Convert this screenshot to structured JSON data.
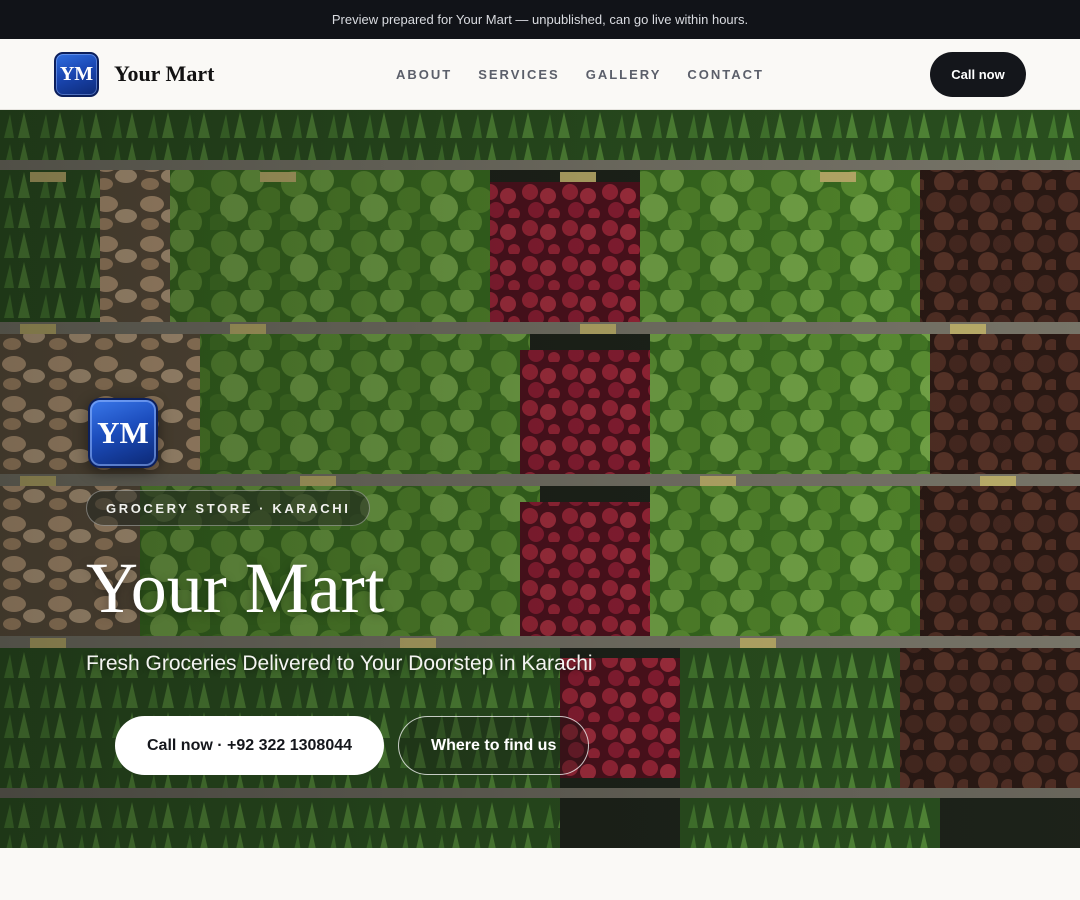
{
  "announcement": "Preview prepared for Your Mart — unpublished, can go live within hours.",
  "brand": {
    "monogram": "YM",
    "name": "Your Mart"
  },
  "nav": {
    "links": [
      "ABOUT",
      "SERVICES",
      "GALLERY",
      "CONTACT"
    ],
    "cta": "Call now"
  },
  "hero": {
    "monogram": "YM",
    "tag": "GROCERY STORE · KARACHI",
    "title": "Your Mart",
    "subtitle": "Fresh Groceries Delivered to Your Doorstep in Karachi",
    "primary_cta": "Call now · +92 322 1308044",
    "secondary_cta": "Where to find us",
    "background_image": "produce-shelves-photo"
  },
  "colors": {
    "dark": "#111318",
    "logo_blue": "#1a47b3",
    "page_bg": "#faf9f6",
    "lettuce": "#5f9a32",
    "radish": "#a5233a",
    "beet": "#4a2a22"
  }
}
